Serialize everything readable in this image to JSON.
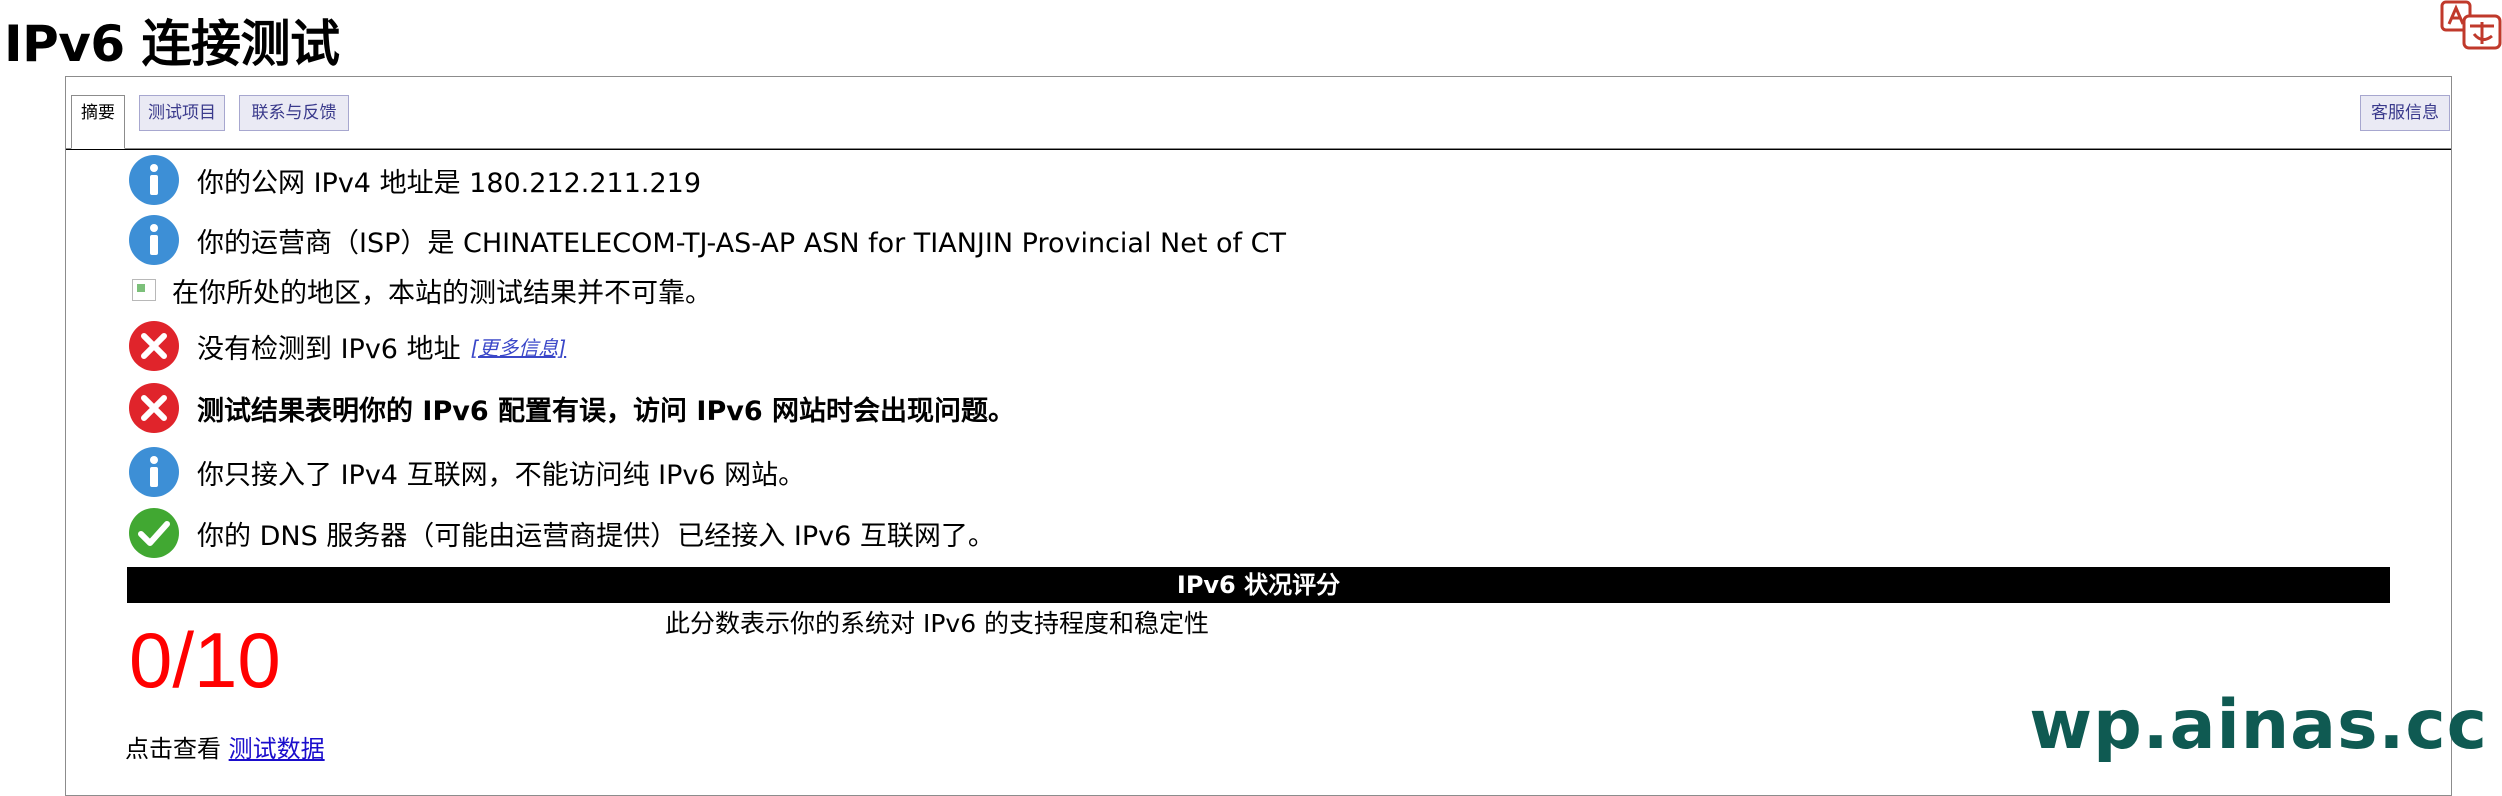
{
  "page": {
    "title": "IPv6 连接测试"
  },
  "tabs": [
    {
      "label": "摘要"
    },
    {
      "label": "测试项目"
    },
    {
      "label": "联系与反馈"
    },
    {
      "label": "客服信息"
    }
  ],
  "results": [
    {
      "icon": "info-icon",
      "text": "你的公网 IPv4 地址是 180.212.211.219"
    },
    {
      "icon": "info-icon",
      "text": "你的运营商（ISP）是 CHINATELECOM-TJ-AS-AP ASN for TIANJIN Provincial Net of CT"
    },
    {
      "icon": "broken-image-icon",
      "text": "在你所处的地区，本站的测试结果并不可靠。"
    },
    {
      "icon": "error-icon",
      "text": "没有检测到 IPv6 地址",
      "link": "[更多信息]"
    },
    {
      "icon": "error-icon",
      "text": "测试结果表明你的 IPv6 配置有误，访问 IPv6 网站时会出现问题。"
    },
    {
      "icon": "info-icon",
      "text": "你只接入了 IPv4 互联网，不能访问纯 IPv6 网站。"
    },
    {
      "icon": "check-icon",
      "text": "你的 DNS 服务器（可能由运营商提供）已经接入 IPv6 互联网了。"
    }
  ],
  "score": {
    "header": "IPv6 状况评分",
    "value": "0/10",
    "description": "此分数表示你的系统对 IPv6 的支持程度和稳定性"
  },
  "footer": {
    "prefix": "点击查看",
    "link": "测试数据"
  },
  "watermark": "wp.ainas.cc",
  "colors": {
    "info": "#3d8fd6",
    "error": "#e0242b",
    "ok": "#41a832",
    "score": "#ff0000",
    "tab_text": "#3a3a8c"
  }
}
